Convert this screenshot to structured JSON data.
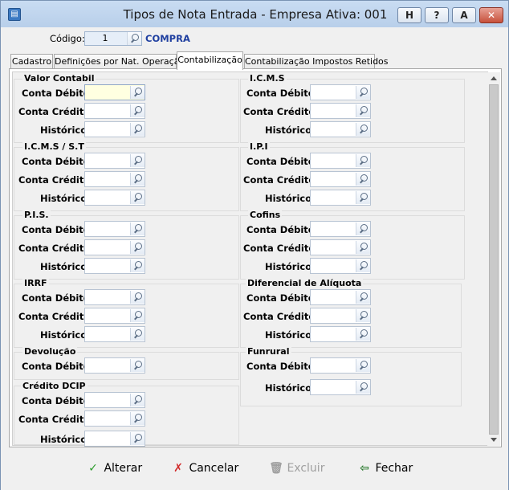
{
  "window": {
    "title": "Tipos de Nota Entrada - Empresa Ativa: 001",
    "help_btn": "H",
    "question_btn": "?",
    "a_btn": "A",
    "close_btn": "✕"
  },
  "codigo": {
    "label": "Código:",
    "value": "1",
    "description": "COMPRA"
  },
  "tabs": [
    {
      "label": "Cadastro"
    },
    {
      "label": "Definições por Nat. Operação"
    },
    {
      "label": "Contabilização"
    },
    {
      "label": "Contabilização Impostos Retidos"
    }
  ],
  "labels": {
    "debito": "Conta Débito:",
    "credito": "Conta Crédito:",
    "historico": "Histórico:"
  },
  "groups": {
    "valor_contabil": "Valor Contabil",
    "icms": "I.C.M.S",
    "icms_st": "I.C.M.S / S.T",
    "ipi": "I.P.I",
    "pis": "P.I.S.",
    "cofins": "Cofins",
    "irrf": "IRRF",
    "diferencial": "Diferencial de Alíquota",
    "devolucao": "Devolução",
    "funrural": "Funrural",
    "credito_dcip": "Crédito DCIP"
  },
  "footer": {
    "alterar": "Alterar",
    "cancelar": "Cancelar",
    "excluir": "Excluir",
    "fechar": "Fechar"
  },
  "colors": {
    "accent": "#1f3fa0",
    "title_bg": "#c9dcf2",
    "focus_field": "#ffffe1"
  }
}
